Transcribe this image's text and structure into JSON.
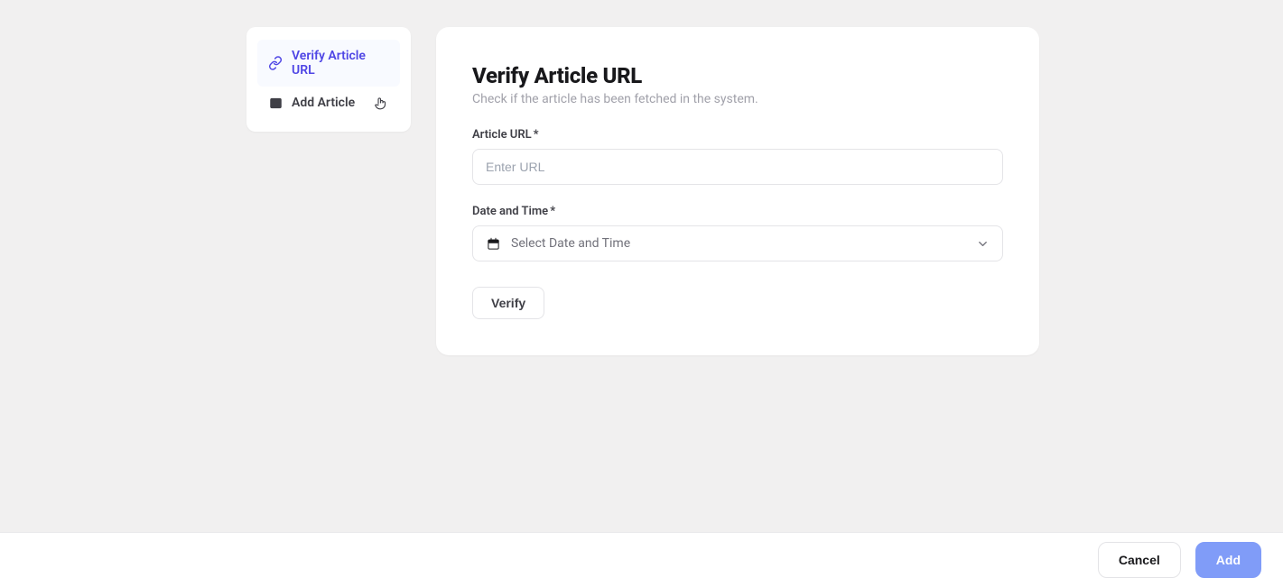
{
  "sidebar": {
    "items": [
      {
        "label": "Verify Article URL"
      },
      {
        "label": "Add Article"
      }
    ]
  },
  "main": {
    "title": "Verify Article URL",
    "subtitle": "Check if the article has been fetched in the system.",
    "fields": {
      "url": {
        "label": "Article URL",
        "placeholder": "Enter URL",
        "required": "*"
      },
      "datetime": {
        "label": "Date and Time",
        "placeholder": "Select Date and Time",
        "required": "*"
      }
    },
    "verify_label": "Verify"
  },
  "footer": {
    "cancel": "Cancel",
    "add": "Add"
  }
}
